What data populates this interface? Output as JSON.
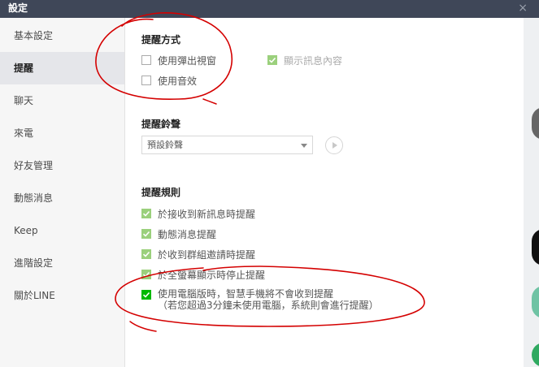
{
  "window": {
    "title": "設定",
    "close_glyph": "×"
  },
  "sidebar": {
    "items": [
      {
        "label": "基本設定"
      },
      {
        "label": "提醒"
      },
      {
        "label": "聊天"
      },
      {
        "label": "來電"
      },
      {
        "label": "好友管理"
      },
      {
        "label": "動態消息"
      },
      {
        "label": "Keep"
      },
      {
        "label": "進階設定"
      },
      {
        "label": "關於LINE"
      }
    ],
    "active_index": 1
  },
  "notify_method": {
    "title": "提醒方式",
    "popup": {
      "label": "使用彈出視窗",
      "checked": false
    },
    "sound": {
      "label": "使用音效",
      "checked": false
    },
    "show_content": {
      "label": "顯示訊息內容",
      "checked": true,
      "disabled": true
    }
  },
  "ringtone": {
    "title": "提醒鈴聲",
    "selected": "預設鈴聲"
  },
  "rules": {
    "title": "提醒規則",
    "items": [
      {
        "label": "於接收到新訊息時提醒",
        "checked": true
      },
      {
        "label": "動態消息提醒",
        "checked": true
      },
      {
        "label": "於收到群組邀請時提醒",
        "checked": true
      },
      {
        "label": "於全螢幕顯示時停止提醒",
        "checked": true
      },
      {
        "label": "使用電腦版時，智慧手機將不會收到提醒",
        "sublabel": "（若您超過3分鐘未使用電腦，系統則會進行提醒）",
        "checked": true
      }
    ]
  },
  "colors": {
    "titlebar": "#3f4758",
    "accent_green": "#00b900",
    "light_green": "#9bd07c",
    "annotation_red": "#d40000"
  }
}
